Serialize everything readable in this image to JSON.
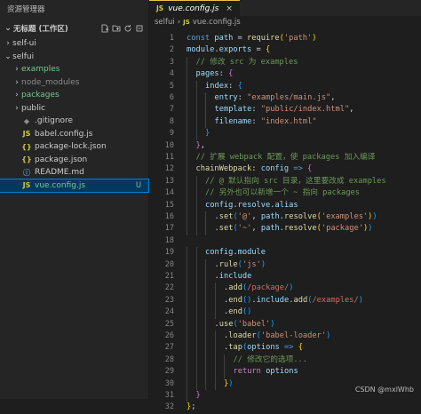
{
  "explorer": {
    "title": "资源管理器",
    "workspace": "无标题 (工作区)",
    "items": [
      {
        "chevron": "›",
        "icon": "",
        "name": "self-ui",
        "badge": "",
        "depth": 0,
        "color": "white",
        "icon_color": "white"
      },
      {
        "chevron": "⌄",
        "icon": "",
        "name": "selfui",
        "badge": "",
        "depth": 0,
        "color": "white",
        "icon_color": "white"
      },
      {
        "chevron": "›",
        "icon": "",
        "name": "examples",
        "badge": "",
        "depth": 1,
        "color": "green",
        "icon_color": "white"
      },
      {
        "chevron": "›",
        "icon": "",
        "name": "node_modules",
        "badge": "",
        "depth": 1,
        "color": "dim",
        "icon_color": "white"
      },
      {
        "chevron": "›",
        "icon": "",
        "name": "packages",
        "badge": "",
        "depth": 1,
        "color": "green",
        "icon_color": "white"
      },
      {
        "chevron": "›",
        "icon": "",
        "name": "public",
        "badge": "",
        "depth": 1,
        "color": "white",
        "icon_color": "white"
      },
      {
        "chevron": "",
        "icon": "◆",
        "name": ".gitignore",
        "badge": "",
        "depth": 1,
        "color": "white",
        "icon_color": "dim"
      },
      {
        "chevron": "",
        "icon": "JS",
        "name": "babel.config.js",
        "badge": "",
        "depth": 1,
        "color": "white",
        "icon_color": "yellow"
      },
      {
        "chevron": "",
        "icon": "{}",
        "name": "package-lock.json",
        "badge": "",
        "depth": 1,
        "color": "white",
        "icon_color": "yellow"
      },
      {
        "chevron": "",
        "icon": "{}",
        "name": "package.json",
        "badge": "",
        "depth": 1,
        "color": "white",
        "icon_color": "yellow"
      },
      {
        "chevron": "",
        "icon": "ⓘ",
        "name": "README.md",
        "badge": "",
        "depth": 1,
        "color": "white",
        "icon_color": "blue"
      },
      {
        "chevron": "",
        "icon": "JS",
        "name": "vue.config.js",
        "badge": "U",
        "depth": 1,
        "color": "green",
        "icon_color": "yellow",
        "selected": true
      }
    ]
  },
  "tab": {
    "icon": "JS",
    "name": "vue.config.js",
    "close": "×"
  },
  "breadcrumb": {
    "folder": "selfui",
    "sep": "›",
    "icon": "JS",
    "file": "vue.config.js"
  },
  "code_lines": [
    {
      "n": "1",
      "indent": 0,
      "tokens": [
        [
          "const ",
          "k-blue"
        ],
        [
          "path",
          "k-var"
        ],
        [
          " = ",
          "k-plain"
        ],
        [
          "require",
          "k-fn"
        ],
        [
          "(",
          "k-b1"
        ],
        [
          "'path'",
          "k-str"
        ],
        [
          ")",
          "k-b1"
        ]
      ]
    },
    {
      "n": "2",
      "indent": 0,
      "tokens": [
        [
          "module",
          "k-var"
        ],
        [
          ".",
          "k-plain"
        ],
        [
          "exports",
          "k-var"
        ],
        [
          " = ",
          "k-plain"
        ],
        [
          "{",
          "k-b1"
        ]
      ]
    },
    {
      "n": "3",
      "indent": 1,
      "tokens": [
        [
          "// 修改 src 为 examples",
          "k-com"
        ]
      ]
    },
    {
      "n": "4",
      "indent": 1,
      "tokens": [
        [
          "pages",
          "k-var"
        ],
        [
          ": ",
          "k-plain"
        ],
        [
          "{",
          "k-b2"
        ]
      ]
    },
    {
      "n": "5",
      "indent": 2,
      "tokens": [
        [
          "index",
          "k-var"
        ],
        [
          ": ",
          "k-plain"
        ],
        [
          "{",
          "k-b3"
        ]
      ]
    },
    {
      "n": "6",
      "indent": 3,
      "tokens": [
        [
          "entry",
          "k-var"
        ],
        [
          ": ",
          "k-plain"
        ],
        [
          "\"examples/main.js\"",
          "k-str"
        ],
        [
          ",",
          "k-plain"
        ]
      ]
    },
    {
      "n": "7",
      "indent": 3,
      "tokens": [
        [
          "template",
          "k-var"
        ],
        [
          ": ",
          "k-plain"
        ],
        [
          "\"public/index.html\"",
          "k-str"
        ],
        [
          ",",
          "k-plain"
        ]
      ]
    },
    {
      "n": "8",
      "indent": 3,
      "tokens": [
        [
          "filename",
          "k-var"
        ],
        [
          ": ",
          "k-plain"
        ],
        [
          "\"index.html\"",
          "k-str"
        ]
      ]
    },
    {
      "n": "9",
      "indent": 2,
      "tokens": [
        [
          "}",
          "k-b3"
        ]
      ]
    },
    {
      "n": "10",
      "indent": 1,
      "tokens": [
        [
          "}",
          "k-b2"
        ],
        [
          ",",
          "k-plain"
        ]
      ]
    },
    {
      "n": "11",
      "indent": 1,
      "tokens": [
        [
          "// 扩展 webpack 配置，使 packages 加入编译",
          "k-com"
        ]
      ]
    },
    {
      "n": "12",
      "indent": 1,
      "tokens": [
        [
          "chainWebpack",
          "k-fn"
        ],
        [
          ": ",
          "k-plain"
        ],
        [
          "config",
          "k-var"
        ],
        [
          " => ",
          "k-blue"
        ],
        [
          "{",
          "k-b2"
        ]
      ]
    },
    {
      "n": "13",
      "indent": 2,
      "tokens": [
        [
          "// @ 默认指向 src 目录，这里要改成 examples",
          "k-com"
        ]
      ]
    },
    {
      "n": "14",
      "indent": 2,
      "tokens": [
        [
          "// 另外也可以新增一个 ~ 指向 packages",
          "k-com"
        ]
      ]
    },
    {
      "n": "15",
      "indent": 2,
      "tokens": [
        [
          "config",
          "k-var"
        ],
        [
          ".",
          "k-plain"
        ],
        [
          "resolve",
          "k-var"
        ],
        [
          ".",
          "k-plain"
        ],
        [
          "alias",
          "k-var"
        ]
      ]
    },
    {
      "n": "16",
      "indent": 3,
      "tokens": [
        [
          ".",
          "k-plain"
        ],
        [
          "set",
          "k-fn"
        ],
        [
          "(",
          "k-b3"
        ],
        [
          "'@'",
          "k-str"
        ],
        [
          ", ",
          "k-plain"
        ],
        [
          "path",
          "k-var"
        ],
        [
          ".",
          "k-plain"
        ],
        [
          "resolve",
          "k-fn"
        ],
        [
          "(",
          "k-b1"
        ],
        [
          "'examples'",
          "k-str"
        ],
        [
          ")",
          "k-b1"
        ],
        [
          ")",
          "k-b3"
        ]
      ]
    },
    {
      "n": "17",
      "indent": 3,
      "tokens": [
        [
          ".",
          "k-plain"
        ],
        [
          "set",
          "k-fn"
        ],
        [
          "(",
          "k-b3"
        ],
        [
          "'~'",
          "k-str"
        ],
        [
          ", ",
          "k-plain"
        ],
        [
          "path",
          "k-var"
        ],
        [
          ".",
          "k-plain"
        ],
        [
          "resolve",
          "k-fn"
        ],
        [
          "(",
          "k-b1"
        ],
        [
          "'package'",
          "k-str"
        ],
        [
          ")",
          "k-b1"
        ],
        [
          ")",
          "k-b3"
        ]
      ]
    },
    {
      "n": "18",
      "indent": 0,
      "tokens": []
    },
    {
      "n": "19",
      "indent": 2,
      "tokens": [
        [
          "config",
          "k-var"
        ],
        [
          ".",
          "k-plain"
        ],
        [
          "module",
          "k-var"
        ]
      ]
    },
    {
      "n": "20",
      "indent": 3,
      "tokens": [
        [
          ".",
          "k-plain"
        ],
        [
          "rule",
          "k-fn"
        ],
        [
          "(",
          "k-b3"
        ],
        [
          "'js'",
          "k-str"
        ],
        [
          ")",
          "k-b3"
        ]
      ]
    },
    {
      "n": "21",
      "indent": 3,
      "tokens": [
        [
          ".",
          "k-plain"
        ],
        [
          "include",
          "k-var"
        ]
      ]
    },
    {
      "n": "22",
      "indent": 4,
      "tokens": [
        [
          ".",
          "k-plain"
        ],
        [
          "add",
          "k-fn"
        ],
        [
          "(",
          "k-b3"
        ],
        [
          "/package/",
          "k-regex"
        ],
        [
          ")",
          "k-b3"
        ]
      ]
    },
    {
      "n": "23",
      "indent": 4,
      "tokens": [
        [
          ".",
          "k-plain"
        ],
        [
          "end",
          "k-fn"
        ],
        [
          "()",
          "k-b3"
        ],
        [
          ".",
          "k-plain"
        ],
        [
          "include",
          "k-var"
        ],
        [
          ".",
          "k-plain"
        ],
        [
          "add",
          "k-fn"
        ],
        [
          "(",
          "k-b3"
        ],
        [
          "/examples/",
          "k-regex"
        ],
        [
          ")",
          "k-b3"
        ]
      ]
    },
    {
      "n": "24",
      "indent": 4,
      "tokens": [
        [
          ".",
          "k-plain"
        ],
        [
          "end",
          "k-fn"
        ],
        [
          "()",
          "k-b3"
        ]
      ]
    },
    {
      "n": "25",
      "indent": 3,
      "tokens": [
        [
          ".",
          "k-plain"
        ],
        [
          "use",
          "k-fn"
        ],
        [
          "(",
          "k-b3"
        ],
        [
          "'babel'",
          "k-str"
        ],
        [
          ")",
          "k-b3"
        ]
      ]
    },
    {
      "n": "26",
      "indent": 4,
      "tokens": [
        [
          ".",
          "k-plain"
        ],
        [
          "loader",
          "k-fn"
        ],
        [
          "(",
          "k-b3"
        ],
        [
          "'babel-loader'",
          "k-str"
        ],
        [
          ")",
          "k-b3"
        ]
      ]
    },
    {
      "n": "27",
      "indent": 4,
      "tokens": [
        [
          ".",
          "k-plain"
        ],
        [
          "tap",
          "k-fn"
        ],
        [
          "(",
          "k-b3"
        ],
        [
          "options",
          "k-var"
        ],
        [
          " => ",
          "k-blue"
        ],
        [
          "{",
          "k-b1"
        ]
      ]
    },
    {
      "n": "28",
      "indent": 5,
      "tokens": [
        [
          "// 修改它的选项...",
          "k-com"
        ]
      ]
    },
    {
      "n": "29",
      "indent": 5,
      "tokens": [
        [
          "return ",
          "k-ctrl"
        ],
        [
          "options",
          "k-var"
        ]
      ]
    },
    {
      "n": "30",
      "indent": 4,
      "tokens": [
        [
          "}",
          "k-b1"
        ],
        [
          ")",
          "k-b3"
        ]
      ]
    },
    {
      "n": "31",
      "indent": 1,
      "tokens": [
        [
          "}",
          "k-b2"
        ]
      ]
    },
    {
      "n": "32",
      "indent": 0,
      "tokens": [
        [
          "}",
          "k-b1"
        ],
        [
          ";",
          "k-plain"
        ]
      ]
    }
  ],
  "watermark": "CSDN @mxlWhb",
  "colors": {
    "editor_bg": "#1e1e1e",
    "sidebar_bg": "#252526",
    "selected_bg": "#04395e",
    "untracked_green": "#73c991"
  }
}
